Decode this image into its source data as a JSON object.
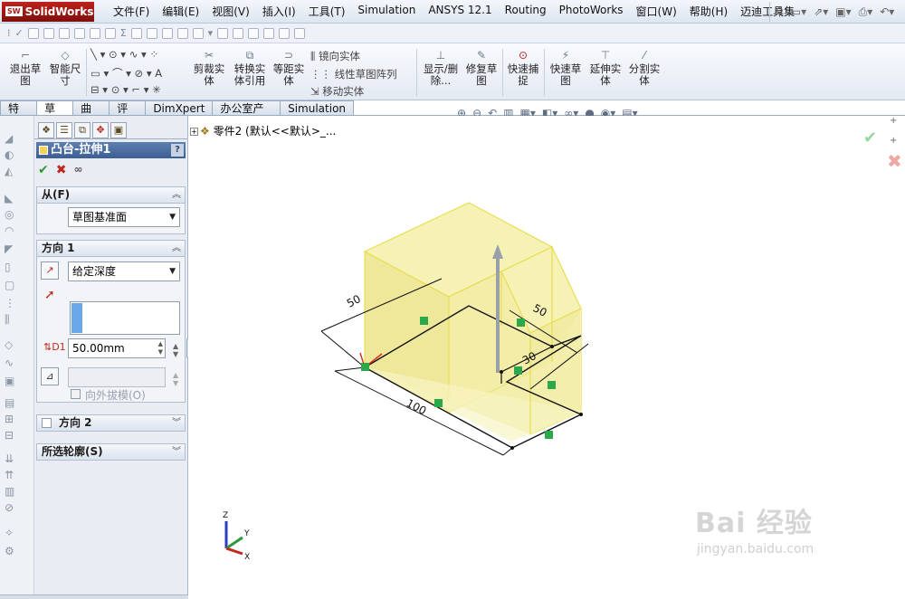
{
  "app": {
    "logo_text": "SolidWorks",
    "logo_badge": "SW"
  },
  "menu": [
    "文件(F)",
    "编辑(E)",
    "视图(V)",
    "插入(I)",
    "工具(T)",
    "Simulation",
    "ANSYS 12.1",
    "Routing",
    "PhotoWorks",
    "窗口(W)",
    "帮助(H)",
    "迈迪工具集"
  ],
  "commands": {
    "exit_sketch": "退出草图",
    "smart_dim": "智能尺寸",
    "trim": "剪裁实体",
    "convert": "转换实体引用",
    "offset": "等距实体",
    "mirror": "镜向实体",
    "linear_pattern": "线性草图阵列",
    "move": "移动实体",
    "show_delete": "显示/删除...",
    "repair": "修复草图",
    "quick_snap": "快速捕捉",
    "rapid_sketch": "快速草图",
    "extend": "延伸实体",
    "split": "分割实体"
  },
  "tabs": [
    "特征",
    "草图",
    "曲面",
    "评估",
    "DimXpert",
    "办公室产品",
    "Simulation"
  ],
  "active_tab": "草图",
  "property_manager": {
    "title": "凸台-拉伸1",
    "help": "?",
    "from_group": {
      "label": "从(F)",
      "value": "草图基准面"
    },
    "dir1_group": {
      "label": "方向 1",
      "end_condition": "给定深度",
      "depth": "50.00mm",
      "draft_label": "向外拔模(O)"
    },
    "dir2_group": {
      "label": "方向 2"
    },
    "contours_group": {
      "label": "所选轮廓(S)"
    }
  },
  "graphics": {
    "tree_label": "零件2  (默认<<默认>_...",
    "dims": {
      "d_left": "50",
      "d_top_right": "50",
      "d_small": "30",
      "d_bottom": "100"
    },
    "triad": {
      "x": "X",
      "y": "Y",
      "z": "Z"
    },
    "watermark_big": "Bai 经验",
    "watermark_small": "jingyan.baidu.com"
  },
  "colors": {
    "accent": "#3c5e92",
    "extrude_fill": "#f4efa2",
    "extrude_edge": "#e8e25a",
    "relation_badge": "#2aa84a"
  }
}
